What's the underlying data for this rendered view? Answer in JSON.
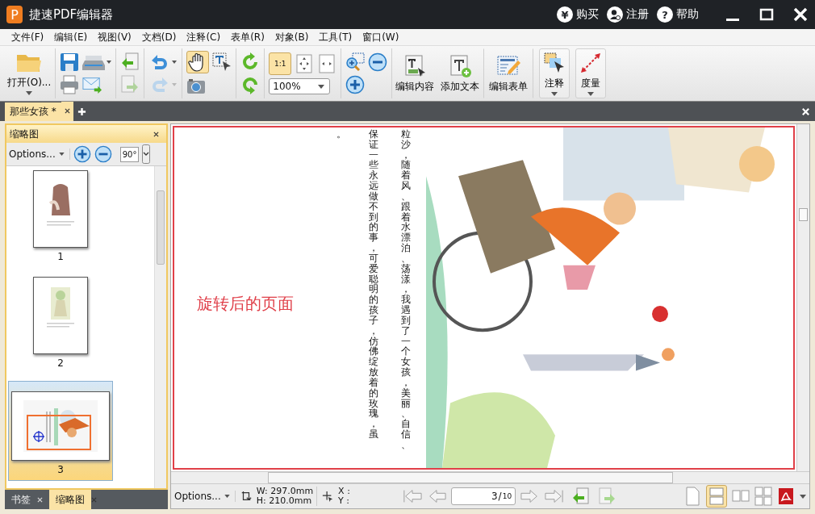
{
  "window": {
    "title": "捷速PDF编辑器",
    "app_icon": "P"
  },
  "title_actions": [
    {
      "kind": "buy",
      "icon": "¥",
      "label": "购买"
    },
    {
      "kind": "register",
      "label": "注册"
    },
    {
      "kind": "help",
      "icon": "?",
      "label": "帮助"
    }
  ],
  "menu": [
    "文件(F)",
    "编辑(E)",
    "视图(V)",
    "文档(D)",
    "注释(C)",
    "表单(R)",
    "对象(B)",
    "工具(T)",
    "窗口(W)"
  ],
  "toolbar": {
    "open_label": "打开(O)...",
    "actual_size": "1:1",
    "zoom": "100%",
    "hand_selected": true,
    "buttons": [
      {
        "kind": "edit",
        "label": "编辑内容"
      },
      {
        "kind": "text",
        "label": "添加文本"
      },
      {
        "kind": "form",
        "label": "编辑表单"
      },
      {
        "kind": "annotate",
        "label": "注释"
      },
      {
        "kind": "measure",
        "label": "度量"
      }
    ]
  },
  "tabs": [
    {
      "label": "那些女孩 *",
      "selected": true
    }
  ],
  "panel": {
    "title": "缩略图",
    "options": "Options...",
    "rotate": "90°",
    "thumbnails": [
      {
        "number": "1",
        "kind": "portrait",
        "selected": false
      },
      {
        "number": "2",
        "kind": "portrait-small",
        "selected": false
      },
      {
        "number": "3",
        "kind": "landscape",
        "selected": true
      }
    ]
  },
  "panel_tabs": [
    {
      "label": "书签",
      "selected": false
    },
    {
      "label": "缩略图",
      "selected": true
    }
  ],
  "page": {
    "annotation": "旋转后的页面",
    "text_columns": [
      "。",
      "保证一些永远做不到的事，可爱聪明的孩子，仿佛绽放着的玫瑰，虽",
      "粒沙，随着风、跟着水漂泊、荡漾，我遇到了一个女孩，美丽、自信、"
    ]
  },
  "status_bar": {
    "options": "Options...",
    "width": "W: 297.0mm",
    "height": "H: 210.0mm",
    "x": "X :",
    "y": "Y :",
    "page_input": "3",
    "page_separator": "/",
    "page_total": "10"
  }
}
